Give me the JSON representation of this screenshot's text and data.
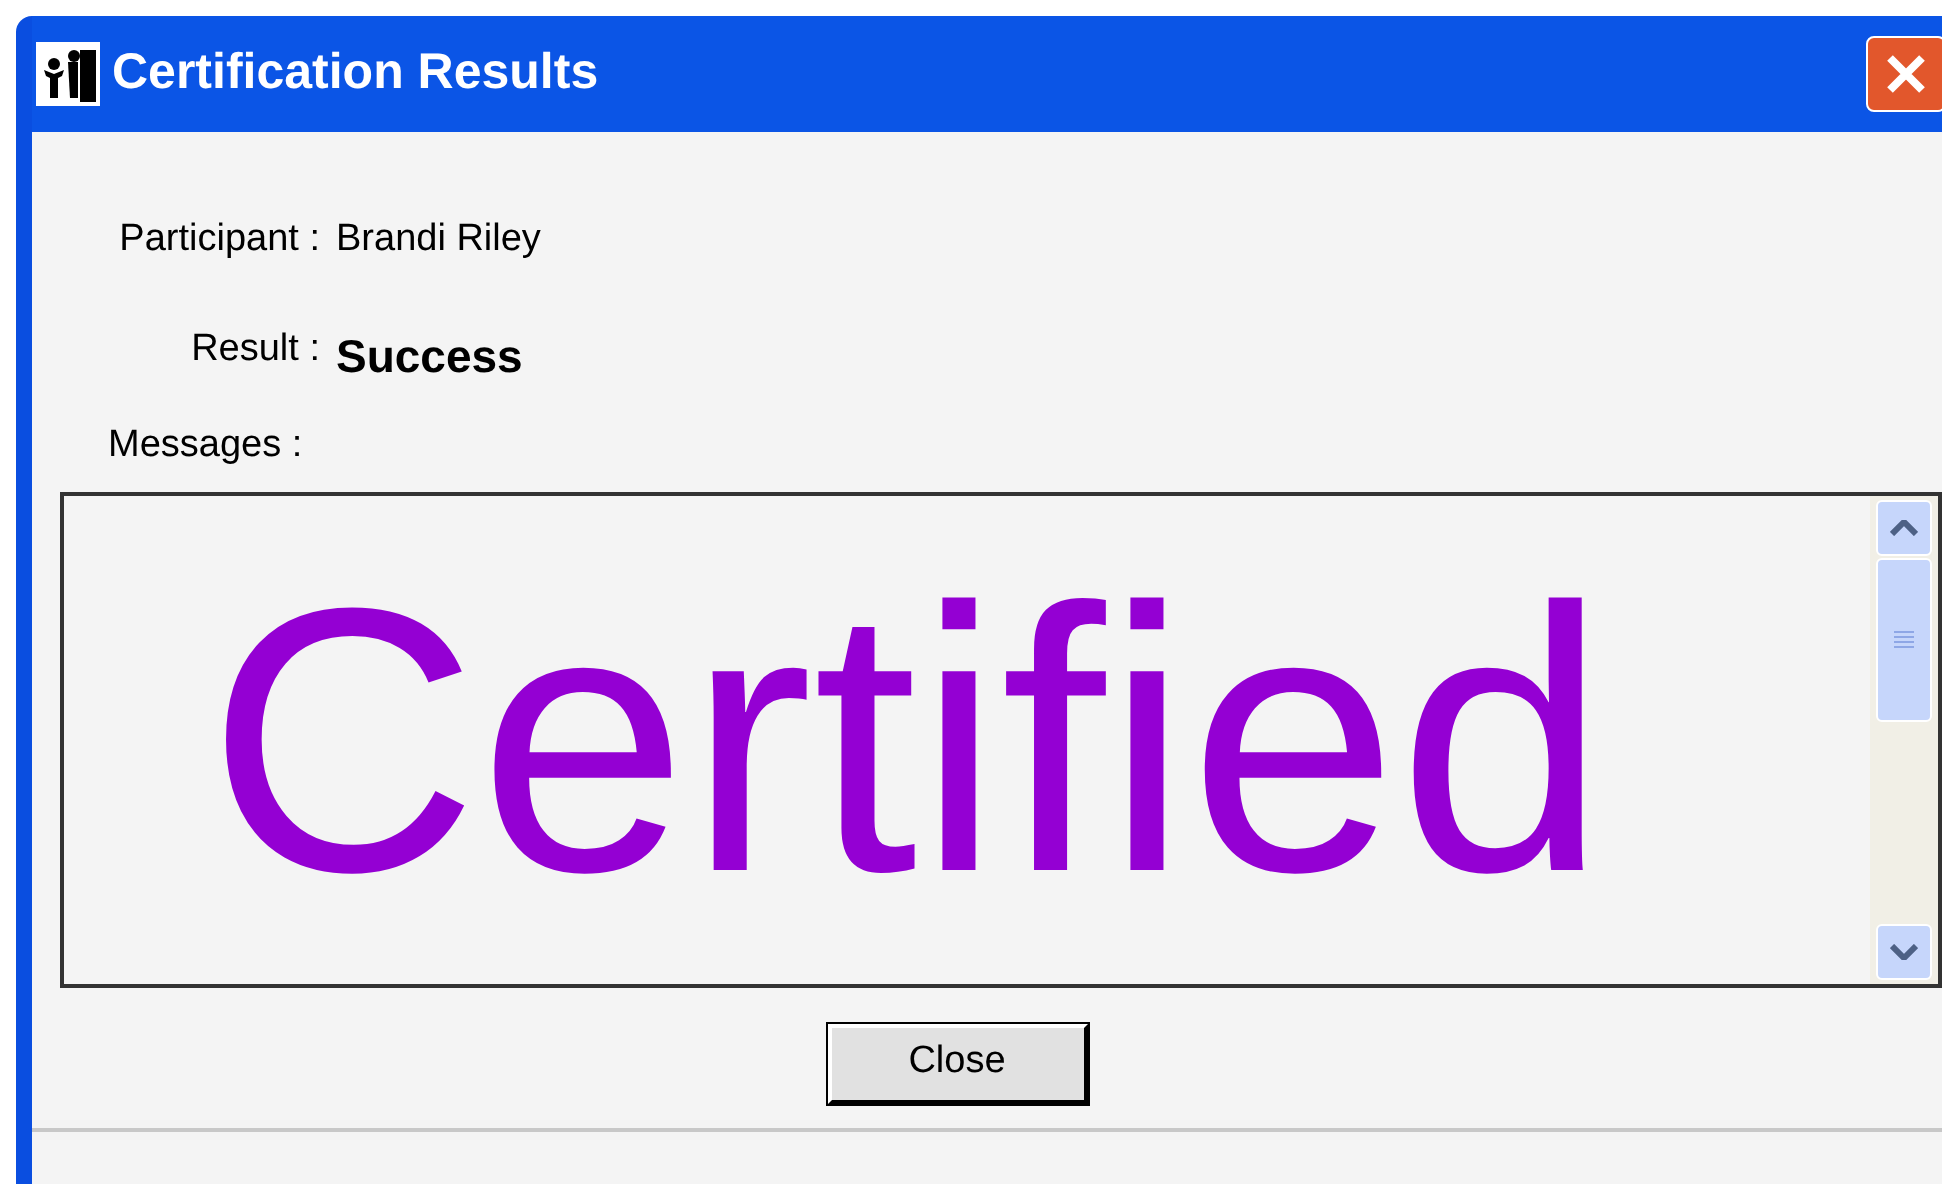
{
  "window": {
    "title": "Certification Results"
  },
  "fields": [
    {
      "kind": "plain",
      "label": "Participant :",
      "value": "Brandi Riley"
    },
    {
      "kind": "emphasis",
      "label": "Result :",
      "value": "Success"
    }
  ],
  "messages": {
    "label": "Messages :",
    "text": "Certified"
  },
  "buttons": [
    {
      "label": "Close"
    }
  ]
}
